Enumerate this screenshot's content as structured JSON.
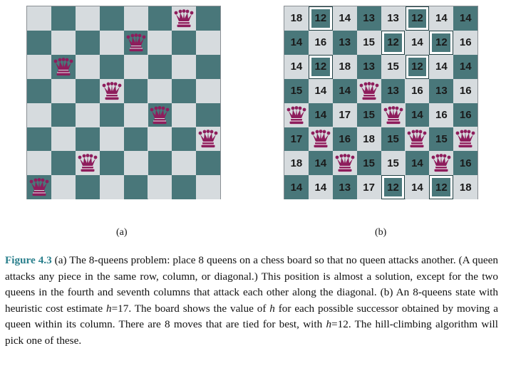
{
  "figure": {
    "board_a": {
      "size": 8,
      "queen_rows_by_column": [
        8,
        3,
        7,
        4,
        2,
        5,
        1,
        6
      ]
    },
    "board_b": {
      "size": 8,
      "queen_rows_by_column": [
        5,
        6,
        7,
        4,
        5,
        6,
        7,
        6
      ],
      "values": [
        [
          "18",
          "12",
          "14",
          "13",
          "13",
          "12",
          "14",
          "14"
        ],
        [
          "14",
          "16",
          "13",
          "15",
          "12",
          "14",
          "12",
          "16"
        ],
        [
          "14",
          "12",
          "18",
          "13",
          "15",
          "12",
          "14",
          "14"
        ],
        [
          "15",
          "14",
          "14",
          "Q",
          "13",
          "16",
          "13",
          "16"
        ],
        [
          "Q",
          "14",
          "17",
          "15",
          "Q",
          "14",
          "16",
          "16"
        ],
        [
          "17",
          "Q",
          "16",
          "18",
          "15",
          "Q",
          "15",
          "Q"
        ],
        [
          "18",
          "14",
          "Q",
          "15",
          "15",
          "14",
          "Q",
          "16"
        ],
        [
          "14",
          "14",
          "13",
          "17",
          "12",
          "14",
          "12",
          "18"
        ]
      ],
      "best_value": "12"
    },
    "colors": {
      "light": "#d6dbde",
      "dark": "#49777a",
      "queen": "#8e1d5c",
      "caption_accent": "#2a7f8c"
    },
    "label_a": "(a)",
    "label_b": "(b)"
  },
  "caption": {
    "figure_label": "Figure 4.3",
    "part1": "(a) The 8-queens problem: place 8 queens on a chess board so that no queen attacks another. (A queen attacks any piece in the same row, column, or diagonal.) This position is almost a solution, except for the two queens in the fourth and seventh columns that attack each other along the diagonal. (b) An 8-queens state with heuristic cost estimate ",
    "h_var_1": "h",
    "eq1": "=17",
    "part2": ". The board shows the value of ",
    "h_var_2": "h",
    "part3": " for each possible successor obtained by moving a queen within its column. There are 8 moves that are tied for best, with ",
    "h_var_3": "h",
    "eq2": "=12",
    "part4": ". The hill-climbing algorithm will pick one of these."
  }
}
